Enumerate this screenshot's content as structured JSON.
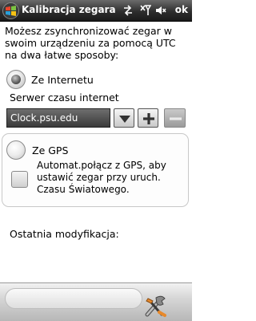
{
  "titlebar": {
    "title": "Kalibracja zegara",
    "ok_label": "ok",
    "icons": [
      "windows-logo-icon",
      "connectivity-arrows-icon",
      "no-signal-antenna-icon",
      "speaker-mute-icon"
    ]
  },
  "intro_text": "Możesz zsynchronizować zegar w swoim urządzeniu za pomocą UTC na dwa łatwe sposoby:",
  "internet_option": {
    "label": "Ze Internetu",
    "selected": true
  },
  "server": {
    "label": "Serwer czasu internet",
    "value": "Clock.psu.edu",
    "buttons": [
      "dropdown-arrow-icon",
      "plus-icon",
      "minus-icon"
    ]
  },
  "gps_option": {
    "label": "Ze GPS",
    "selected": false,
    "checkbox_label": "Automat.połącz z GPS, aby ustawić zegar przy uruch. Czasu Światowego.",
    "checkbox_checked": false
  },
  "last_modified_label": "Ostatnia modyfikacja:",
  "bottombar": {
    "icon": "tools-icon"
  }
}
